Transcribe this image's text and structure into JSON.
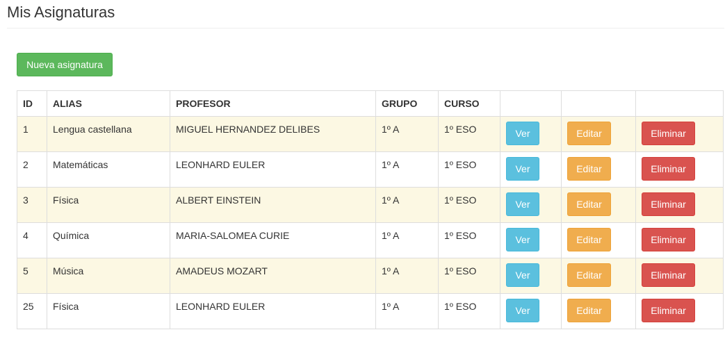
{
  "page": {
    "title": "Mis Asignaturas"
  },
  "toolbar": {
    "new_label": "Nueva asignatura"
  },
  "table": {
    "headers": [
      "ID",
      "ALIAS",
      "PROFESOR",
      "GRUPO",
      "CURSO",
      "",
      "",
      ""
    ],
    "rows": [
      {
        "id": "1",
        "alias": "Lengua castellana",
        "profesor": "MIGUEL HERNANDEZ DELIBES",
        "grupo": "1º A",
        "curso": "1º ESO"
      },
      {
        "id": "2",
        "alias": "Matemáticas",
        "profesor": "LEONHARD EULER",
        "grupo": "1º A",
        "curso": "1º ESO"
      },
      {
        "id": "3",
        "alias": "Física",
        "profesor": "ALBERT EINSTEIN",
        "grupo": "1º A",
        "curso": "1º ESO"
      },
      {
        "id": "4",
        "alias": "Química",
        "profesor": "MARIA-SALOMEA CURIE",
        "grupo": "1º A",
        "curso": "1º ESO"
      },
      {
        "id": "5",
        "alias": "Música",
        "profesor": "AMADEUS MOZART",
        "grupo": "1º A",
        "curso": "1º ESO"
      },
      {
        "id": "25",
        "alias": "Física",
        "profesor": "LEONHARD EULER",
        "grupo": "1º A",
        "curso": "1º ESO"
      }
    ]
  },
  "actions": {
    "view_label": "Ver",
    "edit_label": "Editar",
    "delete_label": "Eliminar"
  },
  "colors": {
    "success": "#5cb85c",
    "info": "#5bc0de",
    "warning": "#f0ad4e",
    "danger": "#d9534f",
    "row_highlight": "#fcf8e3"
  }
}
